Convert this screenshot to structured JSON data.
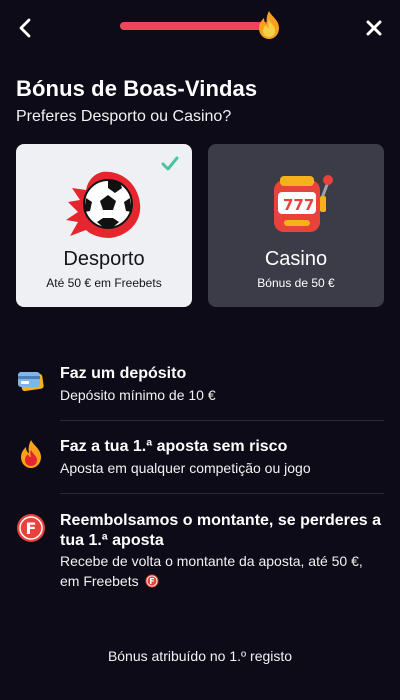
{
  "header": {
    "back_icon": "chevron-left-icon",
    "close_icon": "close-icon",
    "progress_fraction": 1.0,
    "progress_color": "#f0455a"
  },
  "title": "Bónus de Boas-Vindas",
  "subtitle": "Preferes Desporto ou Casino?",
  "cards": [
    {
      "title": "Desporto",
      "subtitle": "Até 50 € em Freebets",
      "selected": true,
      "icon": "soccer-ball-icon"
    },
    {
      "title": "Casino",
      "subtitle": "Bónus de 50 €",
      "selected": false,
      "icon": "slot-machine-icon"
    }
  ],
  "steps": [
    {
      "title": "Faz um depósito",
      "description": "Depósito mínimo de 10 €",
      "icon": "card-icon"
    },
    {
      "title": "Faz a tua 1.ª aposta sem risco",
      "description": "Aposta em qualquer competição ou jogo",
      "icon": "fire-icon"
    },
    {
      "title_line1": "Reembolsamos o montante, se perderes a",
      "title_line2": "tua 1.ª aposta",
      "description_line1": "Recebe de volta o montante da aposta, até 50 €,",
      "description_line2": "em Freebets",
      "icon": "freebet-icon"
    }
  ],
  "footer": "Bónus atribuído no 1.º registo",
  "colors": {
    "accent": "#f0455a",
    "check": "#48c79a",
    "background": "#0c0b17"
  }
}
